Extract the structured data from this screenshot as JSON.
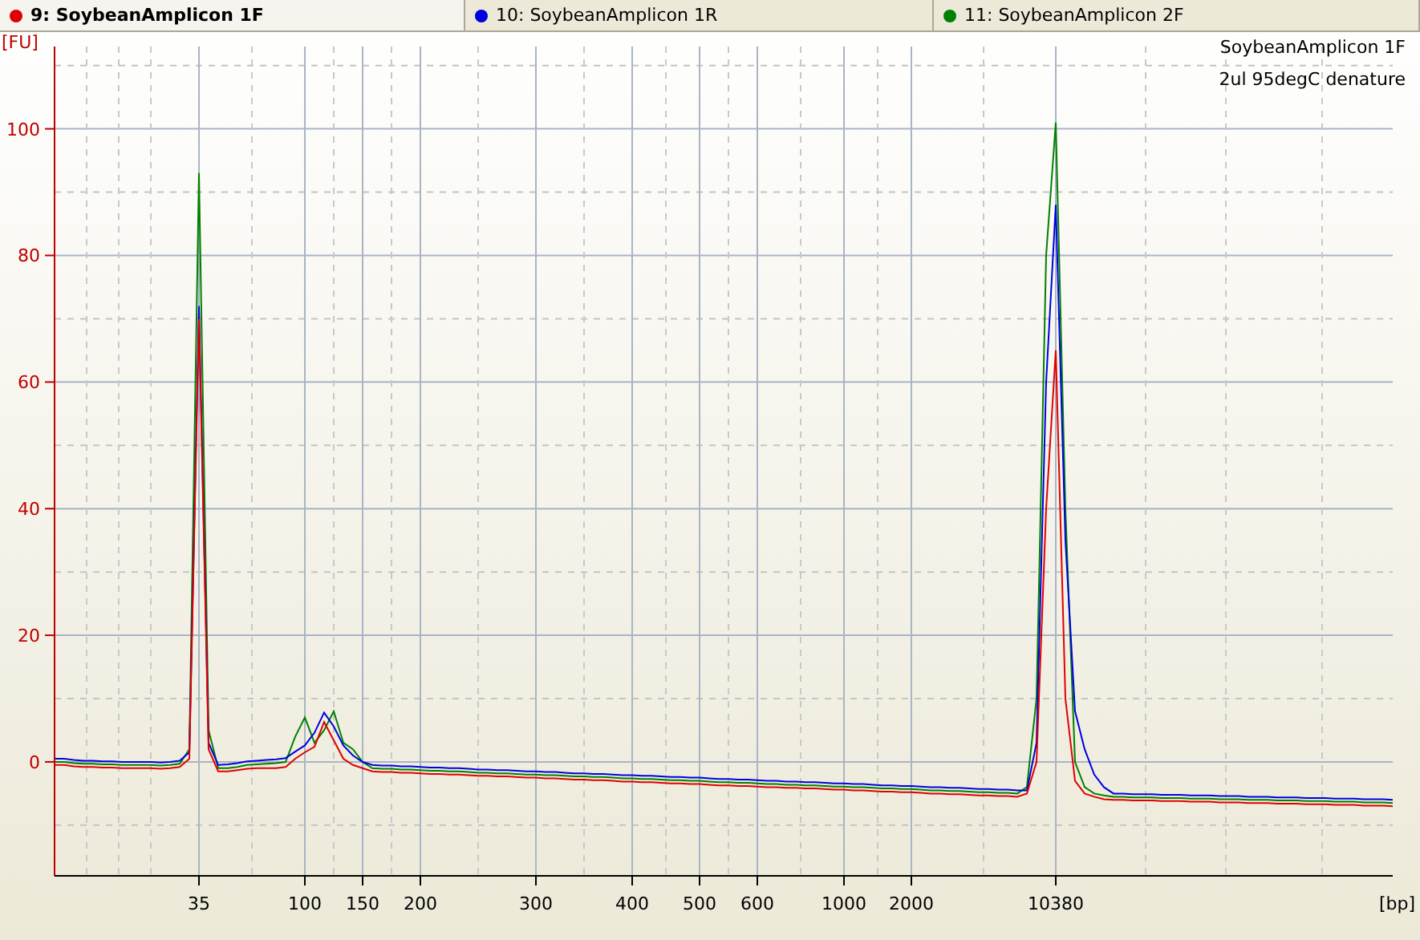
{
  "tabs": [
    {
      "label": "9: SoybeanAmplicon 1F",
      "color": "#e00000",
      "selected": true
    },
    {
      "label": "10: SoybeanAmplicon 1R",
      "color": "#0000e0",
      "selected": false
    },
    {
      "label": "11: SoybeanAmplicon 2F",
      "color": "#008000",
      "selected": false
    }
  ],
  "chart_data": {
    "type": "line",
    "xlabel": "[bp]",
    "ylabel": "[FU]",
    "grid": true,
    "categories": [
      null,
      null,
      null,
      null,
      null,
      null,
      null,
      null,
      null,
      null,
      null,
      null,
      null,
      null,
      null,
      "35",
      null,
      null,
      null,
      null,
      null,
      null,
      null,
      null,
      null,
      null,
      "100",
      null,
      null,
      null,
      null,
      null,
      "150",
      null,
      null,
      null,
      null,
      null,
      "200",
      null,
      null,
      null,
      null,
      null,
      null,
      null,
      null,
      null,
      null,
      null,
      "300",
      null,
      null,
      null,
      null,
      null,
      null,
      null,
      null,
      null,
      "400",
      null,
      null,
      null,
      null,
      null,
      null,
      "500",
      null,
      null,
      null,
      null,
      null,
      "600",
      null,
      null,
      null,
      null,
      null,
      null,
      null,
      null,
      "1000",
      null,
      null,
      null,
      null,
      null,
      null,
      "2000",
      null,
      null,
      null,
      null,
      null,
      null,
      null,
      null,
      null,
      null,
      null,
      null,
      null,
      null,
      "10380",
      null,
      null,
      null,
      null,
      null,
      null,
      null,
      null,
      null,
      null,
      null,
      null,
      null,
      null,
      null,
      null,
      null,
      null,
      null,
      null,
      null,
      null,
      null,
      null,
      null,
      null,
      null,
      null,
      null,
      null,
      null,
      null,
      null,
      null,
      null
    ],
    "ylim": [
      -18,
      113
    ],
    "yticks": [
      0,
      20,
      40,
      60,
      80,
      100
    ],
    "series": [
      {
        "color": "#e00000",
        "values": [
          -0.5,
          -0.5,
          -0.7,
          -0.8,
          -0.8,
          -0.9,
          -0.9,
          -1.0,
          -1.0,
          -1.0,
          -1.0,
          -1.1,
          -1.0,
          -0.8,
          0.5,
          70,
          2,
          -1.5,
          -1.5,
          -1.3,
          -1.1,
          -1.0,
          -1.0,
          -1.0,
          -0.8,
          0.5,
          1.5,
          2.4,
          6.3,
          3.4,
          0.5,
          -0.5,
          -1.0,
          -1.5,
          -1.6,
          -1.6,
          -1.7,
          -1.7,
          -1.8,
          -1.9,
          -1.9,
          -2.0,
          -2.0,
          -2.1,
          -2.2,
          -2.2,
          -2.3,
          -2.3,
          -2.4,
          -2.5,
          -2.5,
          -2.6,
          -2.6,
          -2.7,
          -2.8,
          -2.8,
          -2.9,
          -2.9,
          -3.0,
          -3.1,
          -3.1,
          -3.2,
          -3.2,
          -3.3,
          -3.4,
          -3.4,
          -3.5,
          -3.5,
          -3.6,
          -3.7,
          -3.7,
          -3.8,
          -3.8,
          -3.9,
          -4.0,
          -4.0,
          -4.1,
          -4.1,
          -4.2,
          -4.2,
          -4.3,
          -4.4,
          -4.4,
          -4.5,
          -4.5,
          -4.6,
          -4.7,
          -4.7,
          -4.8,
          -4.8,
          -4.9,
          -5.0,
          -5.0,
          -5.1,
          -5.1,
          -5.2,
          -5.3,
          -5.3,
          -5.4,
          -5.4,
          -5.5,
          -5,
          0,
          40,
          65,
          10,
          -3,
          -5,
          -5.5,
          -5.9,
          -6.0,
          -6.0,
          -6.1,
          -6.1,
          -6.1,
          -6.2,
          -6.2,
          -6.2,
          -6.3,
          -6.3,
          -6.3,
          -6.4,
          -6.4,
          -6.4,
          -6.5,
          -6.5,
          -6.5,
          -6.6,
          -6.6,
          -6.6,
          -6.7,
          -6.7,
          -6.7,
          -6.8,
          -6.8,
          -6.8,
          -6.9,
          -6.9,
          -6.9,
          -7.0
        ]
      },
      {
        "color": "#0000e0",
        "values": [
          0.5,
          0.5,
          0.3,
          0.2,
          0.2,
          0.1,
          0.1,
          0,
          0,
          0,
          0,
          -0.1,
          0,
          0.2,
          1.5,
          72,
          3,
          -0.5,
          -0.4,
          -0.2,
          0.1,
          0.2,
          0.3,
          0.4,
          0.6,
          1.6,
          2.6,
          4.6,
          7.8,
          5.6,
          2.6,
          1.0,
          0,
          -0.5,
          -0.6,
          -0.6,
          -0.7,
          -0.7,
          -0.8,
          -0.9,
          -0.9,
          -1.0,
          -1.0,
          -1.1,
          -1.2,
          -1.2,
          -1.3,
          -1.3,
          -1.4,
          -1.5,
          -1.5,
          -1.6,
          -1.6,
          -1.7,
          -1.8,
          -1.8,
          -1.9,
          -1.9,
          -2.0,
          -2.1,
          -2.1,
          -2.2,
          -2.2,
          -2.3,
          -2.4,
          -2.4,
          -2.5,
          -2.5,
          -2.6,
          -2.7,
          -2.7,
          -2.8,
          -2.8,
          -2.9,
          -3.0,
          -3.0,
          -3.1,
          -3.1,
          -3.2,
          -3.2,
          -3.3,
          -3.4,
          -3.4,
          -3.5,
          -3.5,
          -3.6,
          -3.7,
          -3.7,
          -3.8,
          -3.8,
          -3.9,
          -4.0,
          -4.0,
          -4.1,
          -4.1,
          -4.2,
          -4.3,
          -4.3,
          -4.4,
          -4.4,
          -4.5,
          -4.5,
          3,
          60,
          88,
          35,
          8,
          2,
          -2,
          -4,
          -5.0,
          -5.0,
          -5.1,
          -5.1,
          -5.1,
          -5.2,
          -5.2,
          -5.2,
          -5.3,
          -5.3,
          -5.3,
          -5.4,
          -5.4,
          -5.4,
          -5.5,
          -5.5,
          -5.5,
          -5.6,
          -5.6,
          -5.6,
          -5.7,
          -5.7,
          -5.7,
          -5.8,
          -5.8,
          -5.8,
          -5.9,
          -5.9,
          -5.9,
          -6.0
        ]
      },
      {
        "color": "#008000",
        "values": [
          0,
          0,
          -0.2,
          -0.3,
          -0.3,
          -0.4,
          -0.4,
          -0.5,
          -0.5,
          -0.5,
          -0.5,
          -0.6,
          -0.5,
          -0.3,
          2,
          93,
          5,
          -1,
          -1,
          -0.8,
          -0.5,
          -0.4,
          -0.3,
          -0.2,
          0,
          4,
          7,
          3,
          5,
          8,
          3,
          2,
          0,
          -1.0,
          -1.1,
          -1.1,
          -1.2,
          -1.2,
          -1.3,
          -1.4,
          -1.4,
          -1.5,
          -1.5,
          -1.6,
          -1.7,
          -1.7,
          -1.8,
          -1.8,
          -1.9,
          -2.0,
          -2.0,
          -2.1,
          -2.1,
          -2.2,
          -2.3,
          -2.3,
          -2.4,
          -2.4,
          -2.5,
          -2.6,
          -2.6,
          -2.7,
          -2.7,
          -2.8,
          -2.9,
          -2.9,
          -3.0,
          -3.0,
          -3.1,
          -3.2,
          -3.2,
          -3.3,
          -3.3,
          -3.4,
          -3.5,
          -3.5,
          -3.6,
          -3.6,
          -3.7,
          -3.7,
          -3.8,
          -3.9,
          -3.9,
          -4.0,
          -4.0,
          -4.1,
          -4.2,
          -4.2,
          -4.3,
          -4.3,
          -4.4,
          -4.5,
          -4.5,
          -4.6,
          -4.6,
          -4.7,
          -4.8,
          -4.8,
          -4.9,
          -4.9,
          -5.0,
          -4,
          10,
          80,
          101,
          40,
          0,
          -4,
          -5,
          -5.3,
          -5.5,
          -5.5,
          -5.6,
          -5.6,
          -5.6,
          -5.7,
          -5.7,
          -5.7,
          -5.8,
          -5.8,
          -5.8,
          -5.9,
          -5.9,
          -5.9,
          -6.0,
          -6.0,
          -6.0,
          -6.1,
          -6.1,
          -6.1,
          -6.2,
          -6.2,
          -6.2,
          -6.3,
          -6.3,
          -6.3,
          -6.4,
          -6.4,
          -6.4,
          -6.5
        ]
      }
    ],
    "annotations": [
      "SoybeanAmplicon 1F",
      "2ul 95degC denature"
    ]
  }
}
